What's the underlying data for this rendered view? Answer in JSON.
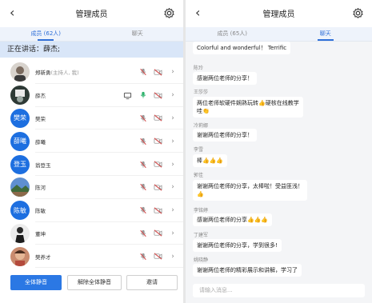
{
  "left": {
    "title": "管理成员",
    "tabs": [
      {
        "label": "成员 (62人)",
        "active": true
      },
      {
        "label": "聊天",
        "active": false
      }
    ],
    "speaking_label": "正在讲话：薛杰;",
    "members": [
      {
        "name": "郑新勇",
        "sub": "(主持人, 我)",
        "avatar": "photo",
        "screen": false,
        "mic": "muted"
      },
      {
        "name": "薛杰",
        "sub": "",
        "avatar": "photo-dark",
        "screen": true,
        "mic": "active"
      },
      {
        "name": "樊荣",
        "sub": "",
        "avatar_text": "樊荣",
        "screen": false,
        "mic": "muted"
      },
      {
        "name": "薛曦",
        "sub": "",
        "avatar_text": "薛曦",
        "screen": false,
        "mic": "muted"
      },
      {
        "name": "翁登玉",
        "sub": "",
        "avatar_text": "登玉",
        "screen": false,
        "mic": "muted"
      },
      {
        "name": "陈河",
        "sub": "",
        "avatar": "photo-landscape",
        "screen": false,
        "mic": "muted"
      },
      {
        "name": "陈敏",
        "sub": "",
        "avatar_text": "陈敏",
        "screen": false,
        "mic": "muted"
      },
      {
        "name": "董坤",
        "sub": "",
        "avatar": "photo-person",
        "screen": false,
        "mic": "muted"
      },
      {
        "name": "樊养才",
        "sub": "",
        "avatar": "photo-child",
        "screen": false,
        "mic": "muted"
      }
    ],
    "buttons": {
      "mute_all": "全体静音",
      "unmute_all": "解除全体静音",
      "invite": "邀请"
    }
  },
  "right": {
    "title": "管理成员",
    "tabs": [
      {
        "label": "成员 (65人)",
        "active": false
      },
      {
        "label": "聊天",
        "active": true
      }
    ],
    "messages": [
      {
        "sender": "",
        "text": "Colorful and wonderful！ Terrific"
      },
      {
        "sender": "陈玲",
        "text": "感谢两位老师的分享！"
      },
      {
        "sender": "王莎莎",
        "text": "两位老师软硬件娴熟玩转👍硬核在线教学\n哇👏"
      },
      {
        "sender": "冷莉娜",
        "text": "谢谢两位老师的分享！"
      },
      {
        "sender": "李雪",
        "text": "棒👍👍👍"
      },
      {
        "sender": "郭佳",
        "text": "谢谢两位老师的分享，太棒啦！受益匪浅！\n👍"
      },
      {
        "sender": "李铭婷",
        "text": "感谢两位老师的分享👍👍👍"
      },
      {
        "sender": "丁建军",
        "text": "谢谢两位老师的分享，学到很多!"
      },
      {
        "sender": "姚晓静",
        "text": "谢谢两位老师的精彩展示和讲解，学习了"
      }
    ],
    "input_placeholder": "请输入消息..."
  },
  "colors": {
    "accent": "#2b78e4",
    "avatar_blue": "#1d6fe0",
    "speaking_bg": "#d9e6f8",
    "mic_muted": "#d14b4b"
  }
}
